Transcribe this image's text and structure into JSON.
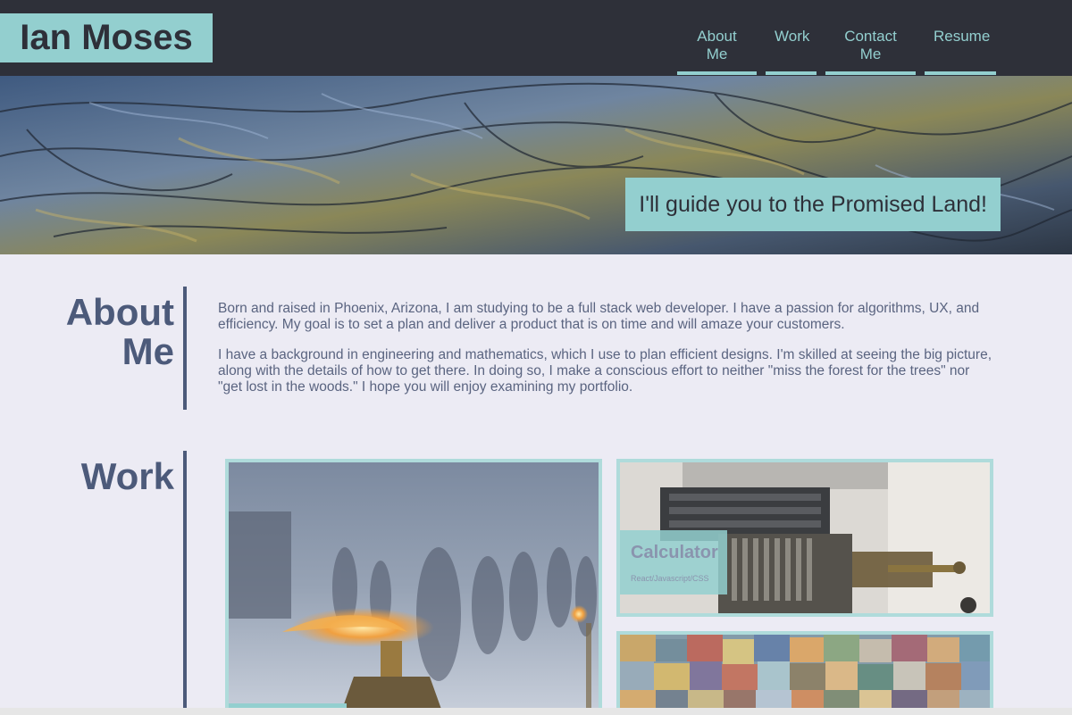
{
  "header": {
    "name": "Ian Moses",
    "nav": [
      {
        "label": "About Me"
      },
      {
        "label": "Work"
      },
      {
        "label": "Contact Me"
      },
      {
        "label": "Resume"
      }
    ]
  },
  "hero": {
    "tagline": "I'll guide you to the Promised Land!"
  },
  "about": {
    "title_line1": "About",
    "title_line2": "Me",
    "paragraphs": [
      "Born and raised in Phoenix, Arizona, I am studying to be a full stack web developer. I have a passion for algorithms, UX, and efficiency. My goal is to set a plan and deliver a product that is on time and will amaze your customers.",
      "I have a background in engineering and mathematics, which I use to plan efficient designs. I'm skilled at seeing the big picture, along with the details of how to get there. In doing so, I make a conscious effort to neither \"miss the forest for the trees\" nor \"get lost in the woods.\" I hope you will enjoy examining my portfolio."
    ]
  },
  "work": {
    "title": "Work",
    "projects": [
      {
        "title": "Calculator",
        "tech": "React/Javascript/CSS"
      }
    ]
  },
  "colors": {
    "accent": "#93cfcf",
    "header_bg": "#2e3039",
    "heading": "#4c5a7a",
    "page_bg": "#ecebf4"
  }
}
